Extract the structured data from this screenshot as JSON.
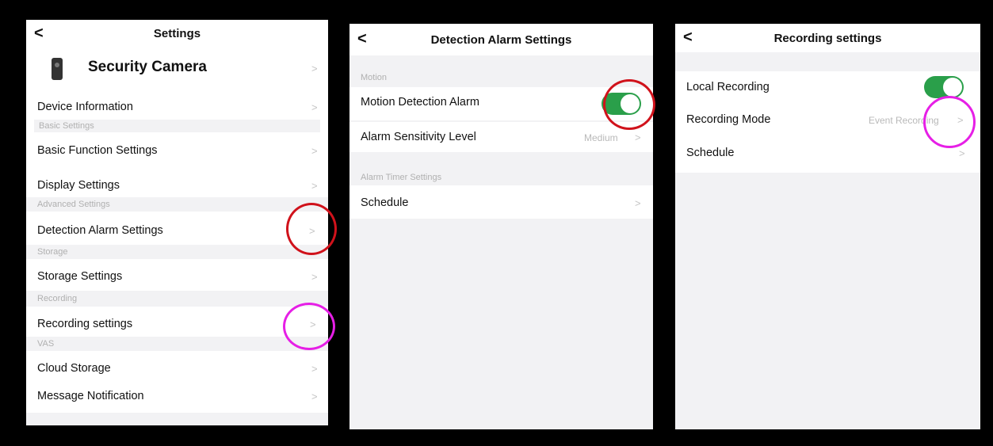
{
  "panel1": {
    "title": "Settings",
    "back_glyph": "<",
    "device_name": "Security Camera",
    "device_icon": "security-camera-icon",
    "items": {
      "device_info": "Device Information",
      "basic_function": "Basic Function Settings",
      "display": "Display Settings",
      "detection_alarm": "Detection Alarm Settings",
      "storage": "Storage Settings",
      "recording": "Recording settings",
      "cloud": "Cloud Storage",
      "message": "Message Notification"
    },
    "sections": {
      "basic": "Basic Settings",
      "advanced": "Advanced Settings",
      "storage": "Storage",
      "recording": "Recording",
      "vas": "VAS"
    }
  },
  "panel2": {
    "title": "Detection Alarm Settings",
    "back_glyph": "<",
    "section_motion": "Motion",
    "motion_alarm": "Motion Detection Alarm",
    "motion_alarm_on": true,
    "sensitivity_label": "Alarm Sensitivity Level",
    "sensitivity_value": "Medium",
    "section_timer": "Alarm Timer Settings",
    "schedule": "Schedule"
  },
  "panel3": {
    "title": "Recording settings",
    "back_glyph": "<",
    "local_recording": "Local Recording",
    "local_recording_on": true,
    "mode_label": "Recording Mode",
    "mode_value": "Event Recording",
    "schedule": "Schedule"
  },
  "chevron": ">",
  "colors": {
    "toggle_on": "#2a9f4a",
    "annotation_red": "#d0121b",
    "annotation_magenta": "#e61fe6",
    "background": "#000000"
  }
}
